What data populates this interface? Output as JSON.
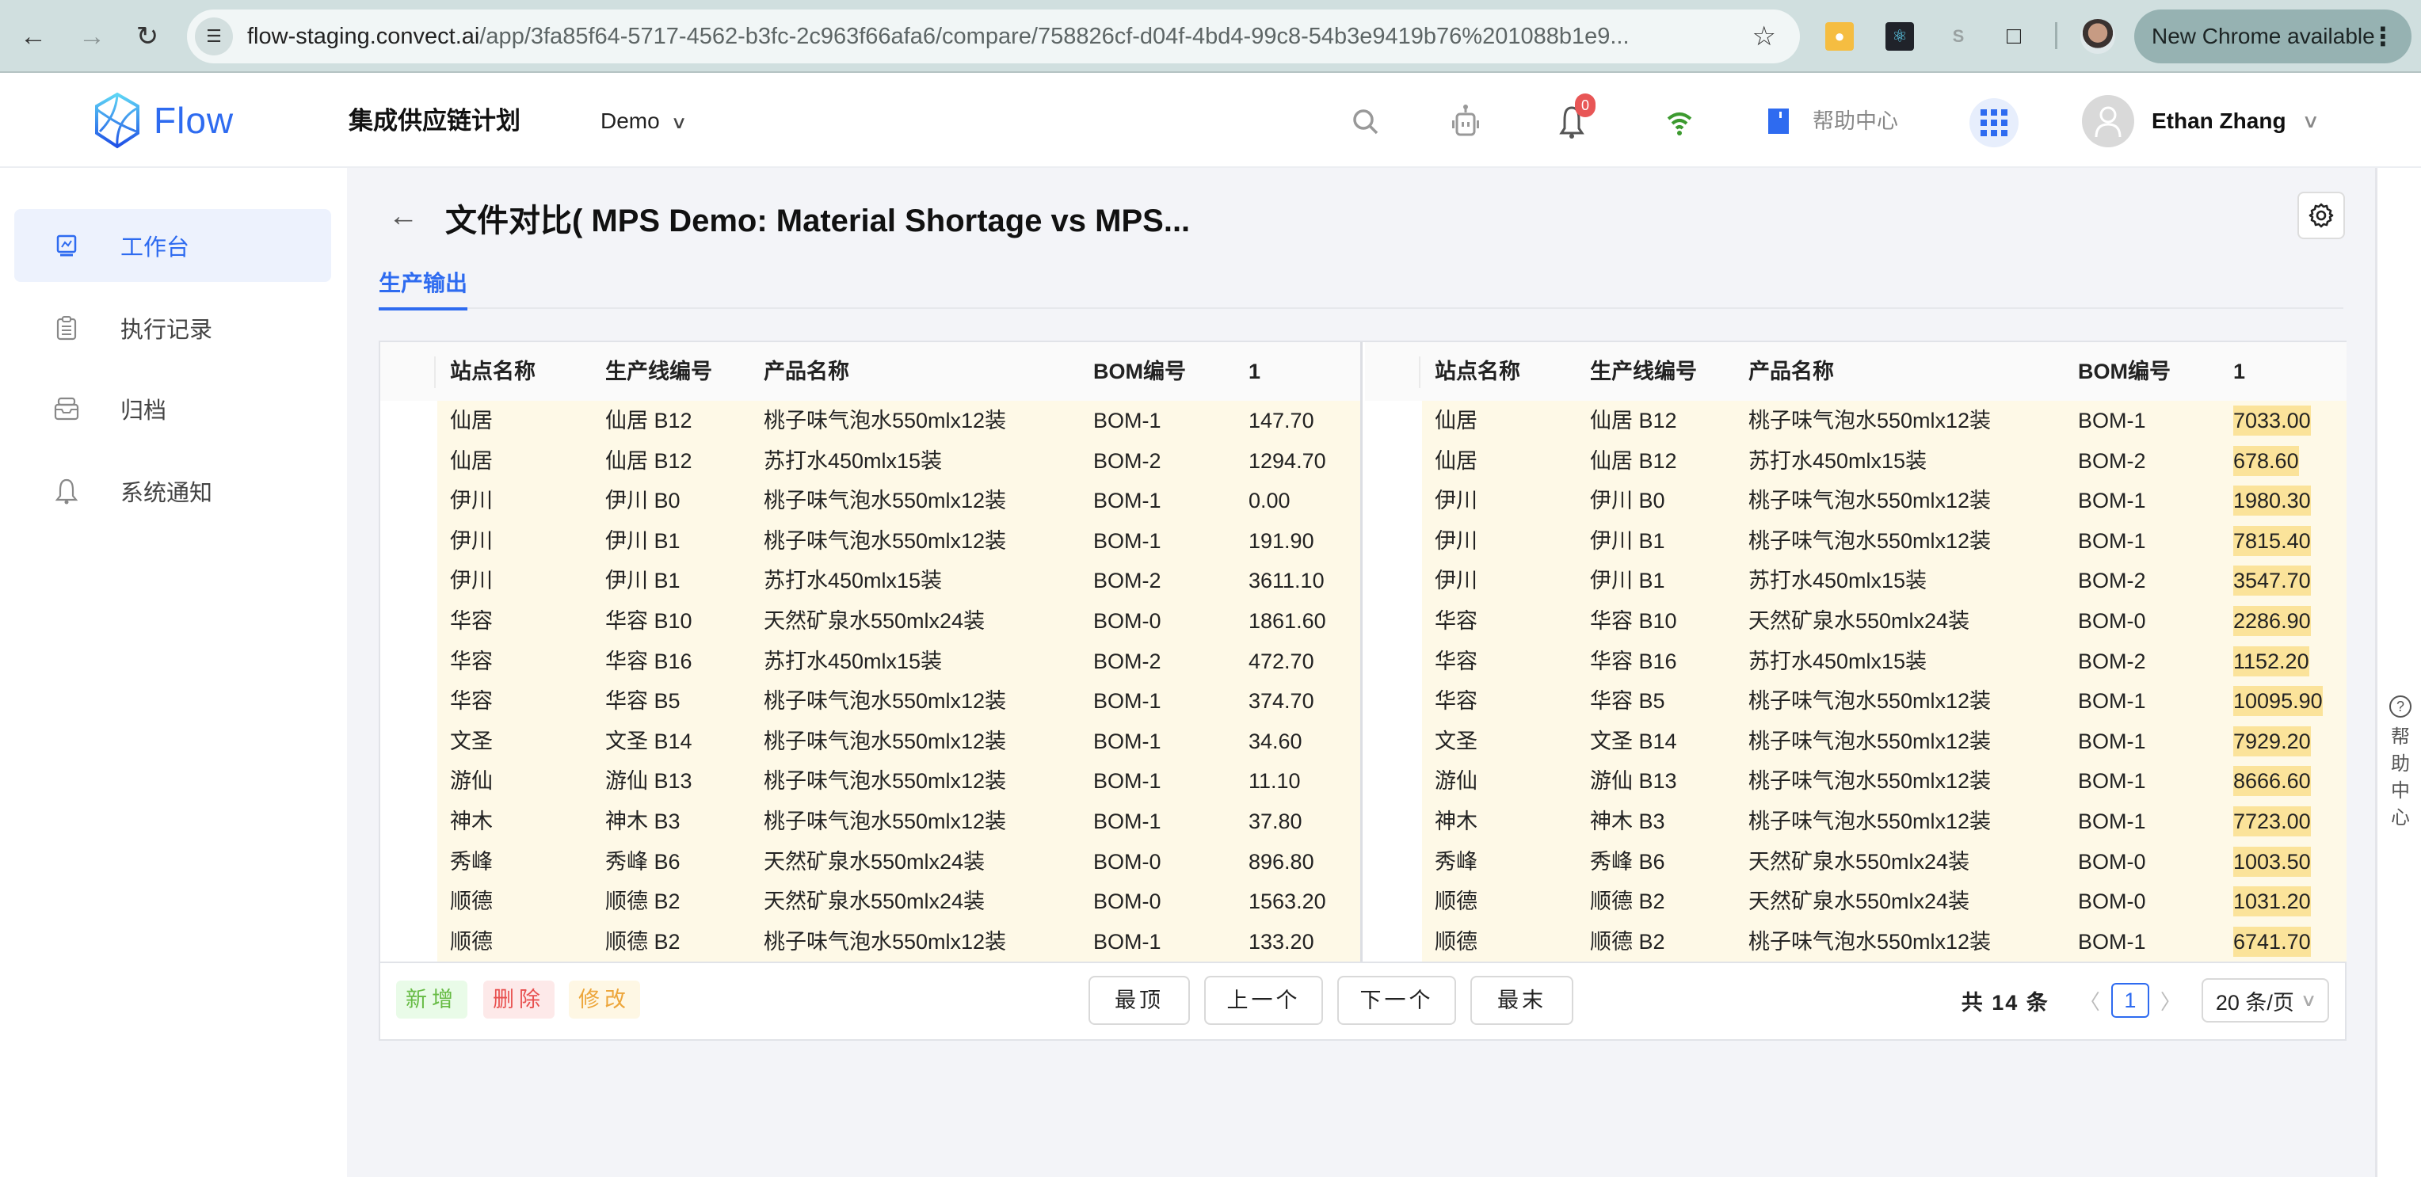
{
  "browser": {
    "url_host": "flow-staging.convect.ai",
    "url_path": "/app/3fa85f64-5717-4562-b3fc-2c963f66afa6/compare/758826cf-d04f-4bd4-99c8-54b3e9419b76%201088b1e9...",
    "update_label": "New Chrome available"
  },
  "header": {
    "logo_text": "Flow",
    "app_title": "集成供应链计划",
    "workspace": "Demo",
    "notification_count": "0",
    "help_label": "帮助中心",
    "user_name": "Ethan Zhang"
  },
  "sidebar": {
    "items": [
      {
        "label": "工作台",
        "icon": "dashboard-icon",
        "active": true
      },
      {
        "label": "执行记录",
        "icon": "clipboard-icon",
        "active": false
      },
      {
        "label": "归档",
        "icon": "archive-icon",
        "active": false
      },
      {
        "label": "系统通知",
        "icon": "bell-icon",
        "active": false
      }
    ]
  },
  "page": {
    "title": "文件对比( MPS Demo: Material Shortage vs MPS...",
    "tabs": [
      {
        "label": "生产输出",
        "active": true
      }
    ]
  },
  "compare": {
    "columns": [
      "站点名称",
      "生产线编号",
      "产品名称",
      "BOM编号",
      "1"
    ],
    "left_rows": [
      [
        "仙居",
        "仙居 B12",
        "桃子味气泡水550mlx12装",
        "BOM-1",
        "147.70"
      ],
      [
        "仙居",
        "仙居 B12",
        "苏打水450mlx15装",
        "BOM-2",
        "1294.70"
      ],
      [
        "伊川",
        "伊川 B0",
        "桃子味气泡水550mlx12装",
        "BOM-1",
        "0.00"
      ],
      [
        "伊川",
        "伊川 B1",
        "桃子味气泡水550mlx12装",
        "BOM-1",
        "191.90"
      ],
      [
        "伊川",
        "伊川 B1",
        "苏打水450mlx15装",
        "BOM-2",
        "3611.10"
      ],
      [
        "华容",
        "华容 B10",
        "天然矿泉水550mlx24装",
        "BOM-0",
        "1861.60"
      ],
      [
        "华容",
        "华容 B16",
        "苏打水450mlx15装",
        "BOM-2",
        "472.70"
      ],
      [
        "华容",
        "华容 B5",
        "桃子味气泡水550mlx12装",
        "BOM-1",
        "374.70"
      ],
      [
        "文圣",
        "文圣 B14",
        "桃子味气泡水550mlx12装",
        "BOM-1",
        "34.60"
      ],
      [
        "游仙",
        "游仙 B13",
        "桃子味气泡水550mlx12装",
        "BOM-1",
        "11.10"
      ],
      [
        "神木",
        "神木 B3",
        "桃子味气泡水550mlx12装",
        "BOM-1",
        "37.80"
      ],
      [
        "秀峰",
        "秀峰 B6",
        "天然矿泉水550mlx24装",
        "BOM-0",
        "896.80"
      ],
      [
        "顺德",
        "顺德 B2",
        "天然矿泉水550mlx24装",
        "BOM-0",
        "1563.20"
      ],
      [
        "顺德",
        "顺德 B2",
        "桃子味气泡水550mlx12装",
        "BOM-1",
        "133.20"
      ]
    ],
    "right_rows": [
      [
        "仙居",
        "仙居 B12",
        "桃子味气泡水550mlx12装",
        "BOM-1",
        "7033.00"
      ],
      [
        "仙居",
        "仙居 B12",
        "苏打水450mlx15装",
        "BOM-2",
        "678.60"
      ],
      [
        "伊川",
        "伊川 B0",
        "桃子味气泡水550mlx12装",
        "BOM-1",
        "1980.30"
      ],
      [
        "伊川",
        "伊川 B1",
        "桃子味气泡水550mlx12装",
        "BOM-1",
        "7815.40"
      ],
      [
        "伊川",
        "伊川 B1",
        "苏打水450mlx15装",
        "BOM-2",
        "3547.70"
      ],
      [
        "华容",
        "华容 B10",
        "天然矿泉水550mlx24装",
        "BOM-0",
        "2286.90"
      ],
      [
        "华容",
        "华容 B16",
        "苏打水450mlx15装",
        "BOM-2",
        "1152.20"
      ],
      [
        "华容",
        "华容 B5",
        "桃子味气泡水550mlx12装",
        "BOM-1",
        "10095.90"
      ],
      [
        "文圣",
        "文圣 B14",
        "桃子味气泡水550mlx12装",
        "BOM-1",
        "7929.20"
      ],
      [
        "游仙",
        "游仙 B13",
        "桃子味气泡水550mlx12装",
        "BOM-1",
        "8666.60"
      ],
      [
        "神木",
        "神木 B3",
        "桃子味气泡水550mlx12装",
        "BOM-1",
        "7723.00"
      ],
      [
        "秀峰",
        "秀峰 B6",
        "天然矿泉水550mlx24装",
        "BOM-0",
        "1003.50"
      ],
      [
        "顺德",
        "顺德 B2",
        "天然矿泉水550mlx24装",
        "BOM-0",
        "1031.20"
      ],
      [
        "顺德",
        "顺德 B2",
        "桃子味气泡水550mlx12装",
        "BOM-1",
        "6741.70"
      ]
    ],
    "right_changed_column": 4,
    "row_status": "modified",
    "colors": {
      "modified_row": "#fef9e7",
      "modified_cell": "#fbe39a",
      "added": "#66bb44",
      "deleted": "#e8504f",
      "modified": "#eda63b",
      "accent": "#2e6bf0"
    }
  },
  "footer": {
    "legend": {
      "added": "新增",
      "deleted": "删除",
      "modified": "修改"
    },
    "nav": {
      "first": "最顶",
      "prev": "上一个",
      "next": "下一个",
      "last": "最末"
    },
    "pagination": {
      "total_label": "共 14 条",
      "current_page": "1",
      "page_size": "20 条/页"
    }
  },
  "help_rail": {
    "label": "帮助中心"
  }
}
